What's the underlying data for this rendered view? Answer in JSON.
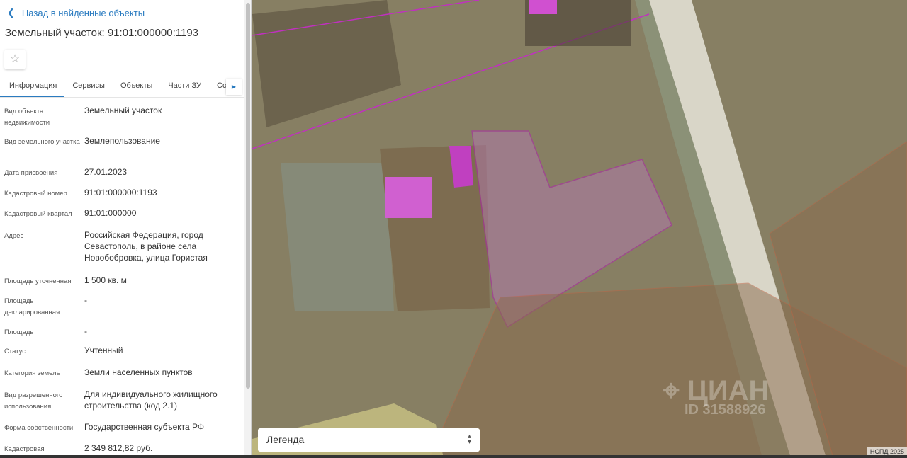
{
  "back_label": "Назад в найденные объекты",
  "title": "Земельный участок: 91:01:000000:1193",
  "tabs": [
    "Информация",
    "Сервисы",
    "Объекты",
    "Части ЗУ",
    "Состав"
  ],
  "rows": [
    {
      "label": "Вид объекта недвижимости",
      "value": "Земельный участок"
    },
    {
      "label": "Вид земельного участка",
      "value": "Землепользование"
    },
    {
      "label": "Дата присвоения",
      "value": "27.01.2023"
    },
    {
      "label": "Кадастровый номер",
      "value": "91:01:000000:1193"
    },
    {
      "label": "Кадастровый квартал",
      "value": "91:01:000000"
    },
    {
      "label": "Адрес",
      "value": "Российская Федерация, город Севастополь, в районе села Новобобровка, улица Гористая"
    },
    {
      "label": "Площадь уточненная",
      "value": "1 500 кв. м"
    },
    {
      "label": "Площадь декларированная",
      "value": "-"
    },
    {
      "label": "Площадь",
      "value": "-"
    },
    {
      "label": "Статус",
      "value": "Учтенный"
    },
    {
      "label": "Категория земель",
      "value": "Земли населенных пунктов"
    },
    {
      "label": "Вид разрешенного использования",
      "value": "Для индивидуального жилищного строительства (код 2.1)"
    },
    {
      "label": "Форма собственности",
      "value": "Государственная субъекта РФ"
    },
    {
      "label": "Кадастровая",
      "value": "2 349 812,82 руб."
    }
  ],
  "legend_label": "Легенда",
  "copyright": "НСПД 2025",
  "watermark": "ЦИАН",
  "watermark_id": "ID 31588926"
}
